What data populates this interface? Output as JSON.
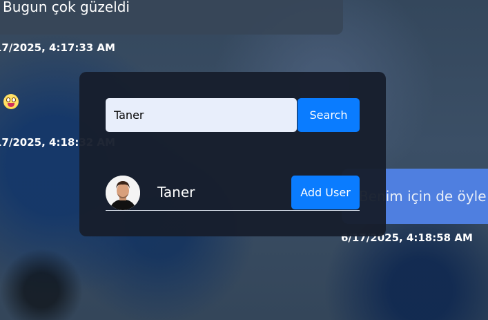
{
  "chat": {
    "messages": [
      {
        "text": "Bugun çok güzeldi",
        "timestamp": "17/2025, 4:17:33 AM"
      },
      {
        "emoji": "face-with-tongue-emoji",
        "timestamp": "17/2025, 4:18:32 AM"
      },
      {
        "text": "Benim için de öyle",
        "timestamp": "6/17/2025, 4:18:58 AM"
      }
    ]
  },
  "modal": {
    "search_value": "Taner",
    "search_label": "Search",
    "result": {
      "name": "Taner",
      "add_label": "Add User"
    }
  },
  "colors": {
    "modal_bg": "#171e2d",
    "primary_button": "#0a7cff",
    "outgoing_bubble": "#4f7fe0",
    "incoming_bubble": "#374658",
    "input_bg": "#e8eefb"
  }
}
